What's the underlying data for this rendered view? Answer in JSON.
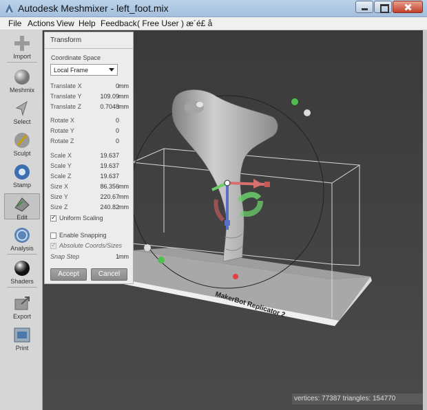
{
  "window": {
    "title": "Autodesk Meshmixer - left_foot.mix"
  },
  "menu": [
    "File",
    "Actions",
    "View",
    "Help",
    "Feedback",
    "( Free User ) æ´é£ å"
  ],
  "toolbar": [
    {
      "label": "Import",
      "icon": "import-icon"
    },
    {
      "label": "Meshmix",
      "icon": "meshmix-icon"
    },
    {
      "label": "Select",
      "icon": "select-icon"
    },
    {
      "label": "Sculpt",
      "icon": "sculpt-icon"
    },
    {
      "label": "Stamp",
      "icon": "stamp-icon"
    },
    {
      "label": "Edit",
      "icon": "edit-icon",
      "active": true
    },
    {
      "label": "Analysis",
      "icon": "analysis-icon"
    },
    {
      "label": "Shaders",
      "icon": "shaders-icon"
    },
    {
      "label": "Export",
      "icon": "export-icon"
    },
    {
      "label": "Print",
      "icon": "print-icon"
    }
  ],
  "transform": {
    "title": "Transform",
    "coord_space_label": "Coordinate Space",
    "coord_space_value": "Local Frame",
    "rows": [
      {
        "label": "Translate X",
        "value": "0",
        "unit": "mm"
      },
      {
        "label": "Translate Y",
        "value": "109.09",
        "unit": "mm"
      },
      {
        "label": "Translate Z",
        "value": "0.7048",
        "unit": "mm"
      },
      {
        "label": "Rotate X",
        "value": "0",
        "unit": ""
      },
      {
        "label": "Rotate Y",
        "value": "0",
        "unit": ""
      },
      {
        "label": "Rotate Z",
        "value": "0",
        "unit": ""
      },
      {
        "label": "Scale X",
        "value": "19.637",
        "unit": ""
      },
      {
        "label": "Scale Y",
        "value": "19.637",
        "unit": ""
      },
      {
        "label": "Scale Z",
        "value": "19.637",
        "unit": ""
      },
      {
        "label": "Size X",
        "value": "86.356",
        "unit": "mm"
      },
      {
        "label": "Size Y",
        "value": "220.67",
        "unit": "mm"
      },
      {
        "label": "Size Z",
        "value": "240.82",
        "unit": "mm"
      }
    ],
    "uniform_scaling": {
      "label": "Uniform Scaling",
      "checked": true
    },
    "enable_snapping": {
      "label": "Enable Snapping",
      "checked": false
    },
    "absolute_coords": {
      "label": "Absolute Coords/Sizes",
      "checked": true
    },
    "snap_step": {
      "label": "Snap Step",
      "value": "1",
      "unit": "mm"
    },
    "accept_label": "Accept",
    "cancel_label": "Cancel"
  },
  "viewport": {
    "printer_label": "MakerBot Replicator 2",
    "status": "vertices: 77387 triangles: 154770"
  }
}
